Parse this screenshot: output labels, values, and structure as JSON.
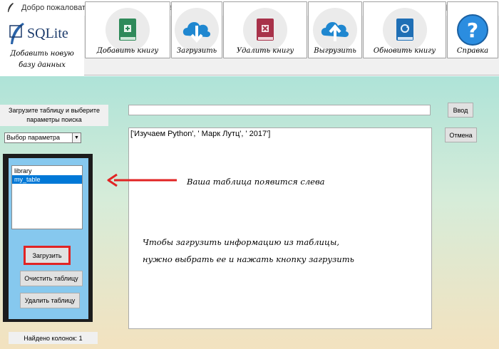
{
  "window": {
    "title": "Добро пожаловать в приложение My library",
    "minimize": "—",
    "maximize": "☐",
    "close": "✕"
  },
  "toolbar": {
    "logo_text": "SQLite",
    "logo_sub_line1": "Добавить новую",
    "logo_sub_line2": "базу данных",
    "buttons": [
      {
        "label": "Добавить книгу",
        "icon": "book-add-icon"
      },
      {
        "label": "Загрузить",
        "icon": "cloud-download-icon"
      },
      {
        "label": "Удалить книгу",
        "icon": "book-delete-icon"
      },
      {
        "label": "Выгрузить",
        "icon": "cloud-upload-icon"
      },
      {
        "label": "Обновить книгу",
        "icon": "book-refresh-icon"
      },
      {
        "label": "Справка",
        "icon": "help-icon"
      }
    ]
  },
  "left": {
    "instruction": "Загрузите таблицу и выберите параметры поиска",
    "param_select": "Выбор параметра",
    "tables": [
      "library",
      "my_table"
    ],
    "selected_table": "my_table",
    "load_button": "Загрузить",
    "clear_button": "Очистить таблицу",
    "delete_button": "Удалить таблицу",
    "found_columns": "Найдено колонок: 1"
  },
  "right": {
    "input_value": "",
    "enter_button": "Ввод",
    "cancel_button": "Отмена",
    "result_line": "['Изучаем Python', ' Марк Лутц', ' 2017']"
  },
  "annotations": {
    "arrow_hint": "Ваша таблица появится слева",
    "instruction_line1": "Чтобы загрузить информацию из таблицы,",
    "instruction_line2": "нужно выбрать ее и нажать кнопку загрузить"
  },
  "colors": {
    "accent_red": "#e12424",
    "selection_blue": "#0078d7",
    "panel_blue": "#86c8ee",
    "book_green": "#2f8a5a",
    "cloud_blue": "#1f87d0",
    "help_blue": "#2b8de0"
  }
}
